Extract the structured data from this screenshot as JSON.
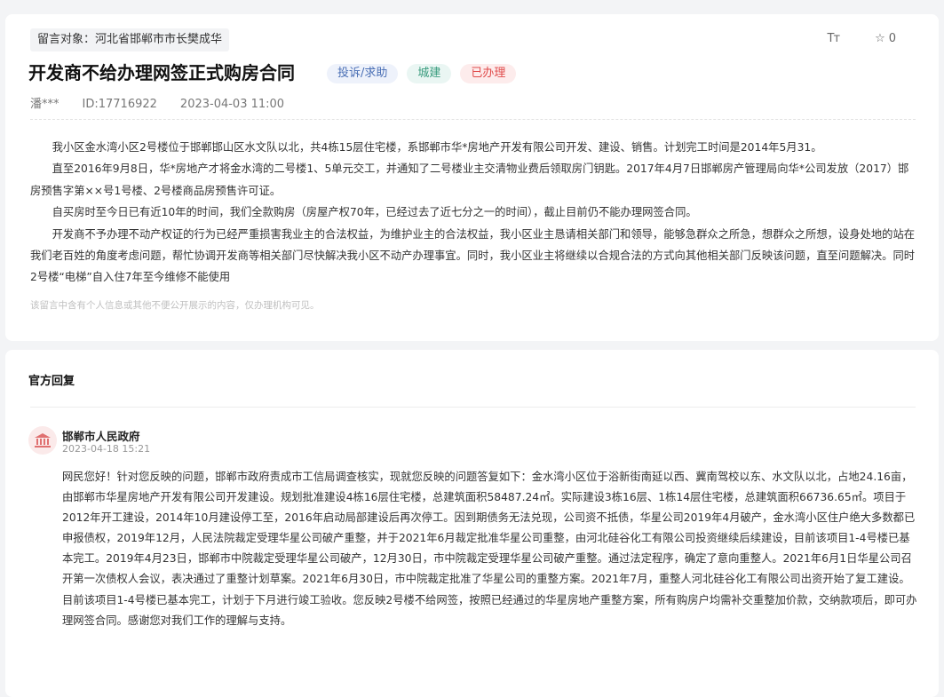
{
  "message": {
    "target_label": "留言对象：河北省邯郸市市长樊成华",
    "font_size_icon": "Tт",
    "favorite_count": "0",
    "title": "开发商不给办理网签正式购房合同",
    "tags": [
      "投诉/求助",
      "城建",
      "已办理"
    ],
    "author": "潘***",
    "id_text": "ID:17716922",
    "datetime": "2023-04-03 11:00",
    "paragraphs": [
      "我小区金水湾小区2号楼位于邯郸邯山区水文队以北，共4栋15层住宅楼，系邯郸市华*房地产开发有限公司开发、建设、销售。计划完工时间是2014年5月31。",
      "直至2016年9月8日，华*房地产才将金水湾的二号楼1、5单元交工，并通知了二号楼业主交清物业费后领取房门钥匙。2017年4月7日邯郸房产管理局向华*公司发放（2017）邯房预售字第××号1号楼、2号楼商品房预售许可证。",
      "自买房时至今日已有近10年的时间，我们全款购房（房屋产权70年，已经过去了近七分之一的时间），截止目前仍不能办理网签合同。",
      "开发商不予办理不动产权证的行为已经严重损害我业主的合法权益，为维护业主的合法权益，我小区业主恳请相关部门和领导，能够急群众之所急，想群众之所想，设身处地的站在我们老百姓的角度考虑问题，帮忙协调开发商等相关部门尽快解决我小区不动产办理事宜。同时，我小区业主将继续以合规合法的方式向其他相关部门反映该问题，直至问题解决。同时2号楼“电梯”自入住7年至今维修不能使用"
    ],
    "privacy_notice": "该留言中含有个人信息或其他不便公开展示的内容，仅办理机构可见。"
  },
  "reply": {
    "section_title": "官方回复",
    "org_name": "邯郸市人民政府",
    "datetime": "2023-04-18 15:21",
    "body": "网民您好！针对您反映的问题，邯郸市政府责成市工信局调查核实，现就您反映的问题答复如下：金水湾小区位于浴新街南延以西、冀南驾校以东、水文队以北，占地24.16亩，由邯郸市华星房地产开发有限公司开发建设。规划批准建设4栋16层住宅楼，总建筑面积58487.24㎡。实际建设3栋16层、1栋14层住宅楼，总建筑面积66736.65㎡。项目于2012年开工建设，2014年10月建设停工至，2016年启动局部建设后再次停工。因到期债务无法兑现，公司资不抵债，华星公司2019年4月破产，金水湾小区住户绝大多数都已申报债权，2019年12月，人民法院裁定受理华星公司破产重整，并于2021年6月裁定批准华星公司重整，由河北硅谷化工有限公司投资继续后续建设，目前该项目1-4号楼已基本完工。2019年4月23日，邯郸市中院裁定受理华星公司破产，12月30日，市中院裁定受理华星公司破产重整。通过法定程序，确定了意向重整人。2021年6月1日华星公司召开第一次债权人会议，表决通过了重整计划草案。2021年6月30日，市中院裁定批准了华星公司的重整方案。2021年7月，重整人河北硅谷化工有限公司出资开始了复工建设。目前该项目1-4号楼已基本完工，计划于下月进行竣工验收。您反映2号楼不给网签，按照已经通过的华星房地产重整方案，所有购房户均需补交重整加价款，交纳款项后，即可办理网签合同。感谢您对我们工作的理解与支持。"
  },
  "colors": {
    "tag_blue": "#4a6fb5",
    "tag_green": "#3a9c7e",
    "tag_red": "#e04a4a",
    "gov_icon": "#e07070"
  }
}
